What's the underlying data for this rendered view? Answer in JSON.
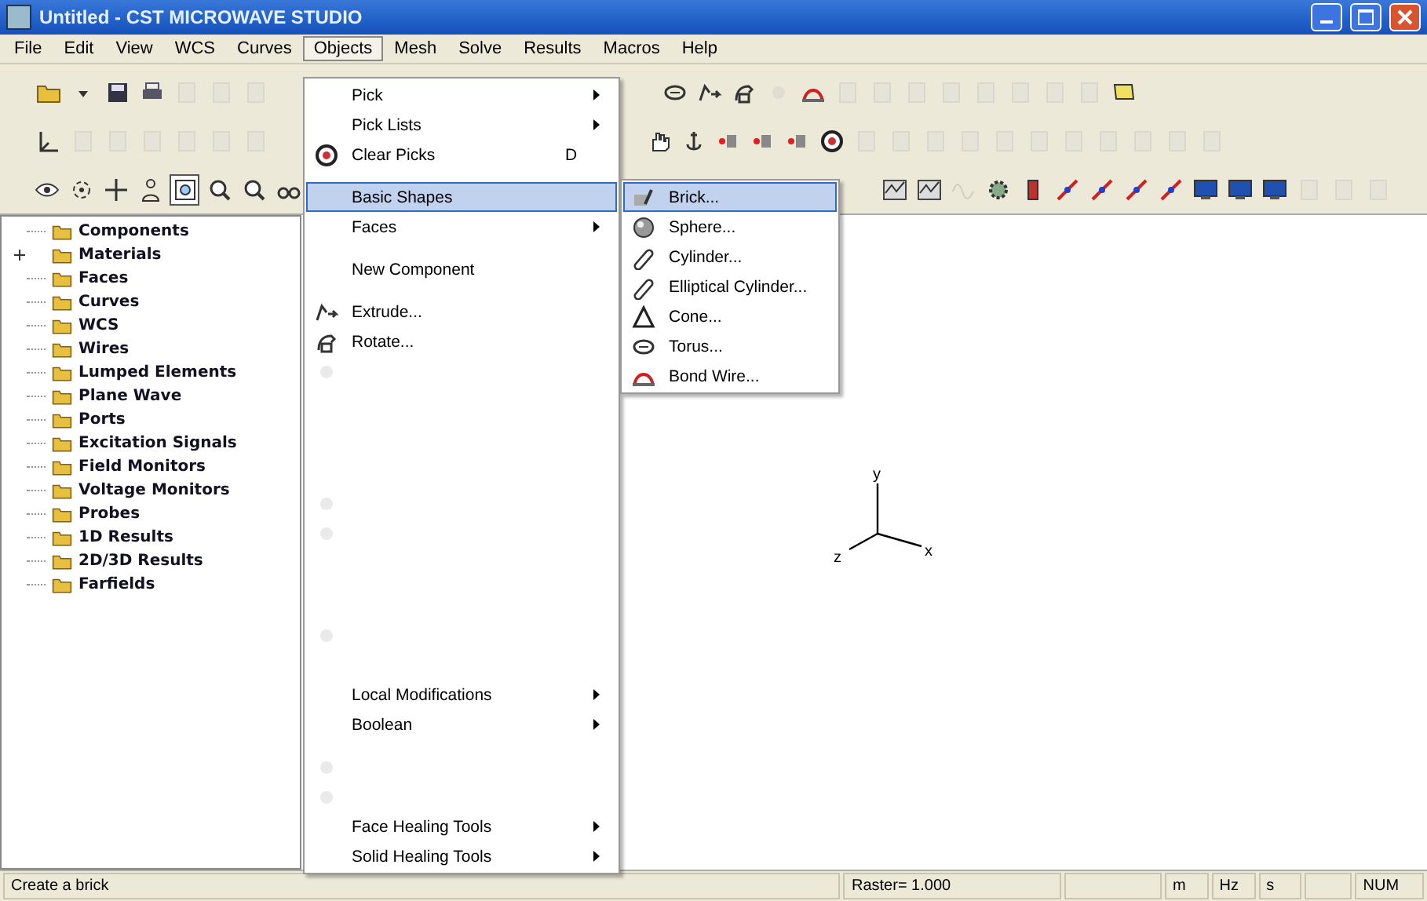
{
  "window": {
    "title": "Untitled - CST MICROWAVE STUDIO"
  },
  "menu_bar": [
    {
      "label": "File",
      "selected": false
    },
    {
      "label": "Edit",
      "selected": false
    },
    {
      "label": "View",
      "selected": false
    },
    {
      "label": "WCS",
      "selected": false
    },
    {
      "label": "Curves",
      "selected": false
    },
    {
      "label": "Objects",
      "selected": true
    },
    {
      "label": "Mesh",
      "selected": false
    },
    {
      "label": "Solve",
      "selected": false
    },
    {
      "label": "Results",
      "selected": false
    },
    {
      "label": "Macros",
      "selected": false
    },
    {
      "label": "Help",
      "selected": false
    }
  ],
  "toolbars": [
    {
      "left": [
        {
          "kind": "folder",
          "disabled": false
        },
        {
          "kind": "caret",
          "disabled": false
        },
        {
          "kind": "disk",
          "disabled": false
        },
        {
          "kind": "printer",
          "disabled": false
        },
        {
          "kind": "doc",
          "disabled": true
        },
        {
          "kind": "doc",
          "disabled": true
        },
        {
          "kind": "doc",
          "disabled": true
        }
      ],
      "right": [
        {
          "kind": "torus",
          "disabled": false
        },
        {
          "kind": "extrude",
          "disabled": false
        },
        {
          "kind": "rotate",
          "disabled": false
        },
        {
          "kind": "blob",
          "disabled": true
        },
        {
          "kind": "bondwire",
          "disabled": false
        },
        {
          "kind": "doc",
          "disabled": true
        },
        {
          "kind": "doc",
          "disabled": true
        },
        {
          "kind": "doc",
          "disabled": true
        },
        {
          "kind": "doc",
          "disabled": true
        },
        {
          "kind": "doc",
          "disabled": true
        },
        {
          "kind": "doc",
          "disabled": true
        },
        {
          "kind": "doc",
          "disabled": true
        },
        {
          "kind": "doc",
          "disabled": true
        },
        {
          "kind": "note",
          "disabled": false
        }
      ]
    },
    {
      "left": [
        {
          "kind": "axes",
          "disabled": false
        },
        {
          "kind": "doc",
          "disabled": true
        },
        {
          "kind": "doc",
          "disabled": true
        },
        {
          "kind": "doc",
          "disabled": true
        },
        {
          "kind": "doc",
          "disabled": true
        },
        {
          "kind": "doc",
          "disabled": true
        },
        {
          "kind": "doc",
          "disabled": true
        }
      ],
      "right": [
        {
          "kind": "hand",
          "disabled": false
        },
        {
          "kind": "anchor",
          "disabled": false
        },
        {
          "kind": "pick",
          "disabled": false
        },
        {
          "kind": "pick",
          "disabled": false
        },
        {
          "kind": "pick",
          "disabled": false
        },
        {
          "kind": "clear",
          "disabled": false
        },
        {
          "kind": "doc",
          "disabled": true
        },
        {
          "kind": "doc",
          "disabled": true
        },
        {
          "kind": "doc",
          "disabled": true
        },
        {
          "kind": "doc",
          "disabled": true
        },
        {
          "kind": "doc",
          "disabled": true
        },
        {
          "kind": "doc",
          "disabled": true
        },
        {
          "kind": "doc",
          "disabled": true
        },
        {
          "kind": "doc",
          "disabled": true
        },
        {
          "kind": "doc",
          "disabled": true
        },
        {
          "kind": "doc",
          "disabled": true
        },
        {
          "kind": "doc",
          "disabled": true
        }
      ]
    },
    {
      "left": [
        {
          "kind": "eye",
          "disabled": false
        },
        {
          "kind": "rotate-view",
          "disabled": false
        },
        {
          "kind": "move",
          "disabled": false
        },
        {
          "kind": "person",
          "disabled": false
        },
        {
          "kind": "zoom-box",
          "disabled": false,
          "pressed": true
        },
        {
          "kind": "magnifier",
          "disabled": false
        },
        {
          "kind": "magnifier",
          "disabled": false
        },
        {
          "kind": "binoculars",
          "disabled": false
        }
      ],
      "right": [
        {
          "kind": "chart",
          "disabled": false
        },
        {
          "kind": "chart",
          "disabled": false
        },
        {
          "kind": "wave",
          "disabled": true
        },
        {
          "kind": "gear",
          "disabled": false
        },
        {
          "kind": "figure",
          "disabled": false
        },
        {
          "kind": "dipole",
          "disabled": false
        },
        {
          "kind": "dipole",
          "disabled": false
        },
        {
          "kind": "dipole",
          "disabled": false
        },
        {
          "kind": "dipole",
          "disabled": false
        },
        {
          "kind": "monitor",
          "disabled": false
        },
        {
          "kind": "monitor",
          "disabled": false
        },
        {
          "kind": "monitor",
          "disabled": false
        },
        {
          "kind": "doc",
          "disabled": true
        },
        {
          "kind": "doc",
          "disabled": true
        },
        {
          "kind": "doc",
          "disabled": true
        }
      ]
    }
  ],
  "tree": {
    "items": [
      {
        "label": "Components",
        "expandable": false
      },
      {
        "label": "Materials",
        "expandable": true
      },
      {
        "label": "Faces",
        "expandable": false
      },
      {
        "label": "Curves",
        "expandable": false
      },
      {
        "label": "WCS",
        "expandable": false
      },
      {
        "label": "Wires",
        "expandable": false
      },
      {
        "label": "Lumped Elements",
        "expandable": false
      },
      {
        "label": "Plane Wave",
        "expandable": false
      },
      {
        "label": "Ports",
        "expandable": false
      },
      {
        "label": "Excitation Signals",
        "expandable": false
      },
      {
        "label": "Field Monitors",
        "expandable": false
      },
      {
        "label": "Voltage Monitors",
        "expandable": false
      },
      {
        "label": "Probes",
        "expandable": false
      },
      {
        "label": "1D Results",
        "expandable": false
      },
      {
        "label": "2D/3D Results",
        "expandable": false
      },
      {
        "label": "Farfields",
        "expandable": false
      }
    ]
  },
  "axes": {
    "x": "x",
    "y": "y",
    "z": "z"
  },
  "objects_menu": [
    {
      "kind": "item",
      "label": "Pick",
      "submenu": true,
      "selected": false
    },
    {
      "kind": "item",
      "label": "Pick Lists",
      "submenu": true,
      "selected": false
    },
    {
      "kind": "item",
      "label": "Clear Picks",
      "shortcut": "D",
      "submenu": false,
      "selected": false
    },
    {
      "kind": "separator"
    },
    {
      "kind": "item",
      "label": "Basic Shapes",
      "submenu": false,
      "selected": true
    },
    {
      "kind": "item",
      "label": "Faces",
      "submenu": true,
      "selected": false
    },
    {
      "kind": "separator"
    },
    {
      "kind": "item",
      "label": "New Component",
      "submenu": false,
      "selected": false
    },
    {
      "kind": "separator"
    },
    {
      "kind": "item",
      "label": "Extrude...",
      "submenu": false,
      "selected": false
    },
    {
      "kind": "item",
      "label": "Rotate...",
      "submenu": false,
      "selected": false
    },
    {
      "kind": "faded-icon"
    },
    {
      "kind": "faded"
    },
    {
      "kind": "faded"
    },
    {
      "kind": "faded"
    },
    {
      "kind": "separator"
    },
    {
      "kind": "faded-icon"
    },
    {
      "kind": "faded-icon"
    },
    {
      "kind": "faded"
    },
    {
      "kind": "faded"
    },
    {
      "kind": "separator"
    },
    {
      "kind": "faded-icon"
    },
    {
      "kind": "faded"
    },
    {
      "kind": "item",
      "label": "Local Modifications",
      "submenu": true,
      "selected": false
    },
    {
      "kind": "item",
      "label": "Boolean",
      "submenu": true,
      "selected": false
    },
    {
      "kind": "separator"
    },
    {
      "kind": "faded-icon"
    },
    {
      "kind": "faded-icon"
    },
    {
      "kind": "item",
      "label": "Face Healing Tools",
      "submenu": true,
      "selected": false
    },
    {
      "kind": "item",
      "label": "Solid Healing Tools",
      "submenu": true,
      "selected": false
    }
  ],
  "shapes_menu": [
    {
      "label": "Brick...",
      "kind": "brick",
      "selected": true
    },
    {
      "label": "Sphere...",
      "kind": "sphere",
      "selected": false
    },
    {
      "label": "Cylinder...",
      "kind": "cylinder",
      "selected": false
    },
    {
      "label": "Elliptical Cylinder...",
      "kind": "cylinder",
      "selected": false
    },
    {
      "label": "Cone...",
      "kind": "cone",
      "selected": false
    },
    {
      "label": "Torus...",
      "kind": "torus",
      "selected": false
    },
    {
      "label": "Bond Wire...",
      "kind": "bondwire",
      "selected": false
    }
  ],
  "status_bar": {
    "message": "Create a brick",
    "raster": "Raster= 1.000",
    "units": [
      "m",
      "Hz",
      "s"
    ],
    "num": "NUM"
  }
}
